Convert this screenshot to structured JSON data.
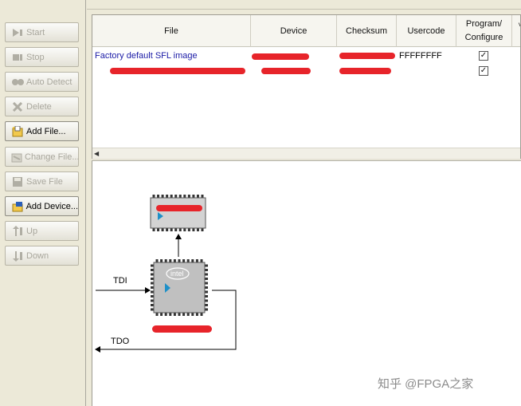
{
  "toolbar": {
    "buttons": [
      {
        "label": "Start",
        "icon": "start-icon",
        "enabled": false
      },
      {
        "label": "Stop",
        "icon": "stop-icon",
        "enabled": false
      },
      {
        "label": "Auto Detect",
        "icon": "auto-detect-icon",
        "enabled": false
      },
      {
        "label": "Delete",
        "icon": "delete-icon",
        "enabled": false
      },
      {
        "label": "Add File...",
        "icon": "add-file-icon",
        "enabled": true
      },
      {
        "label": "Change File...",
        "icon": "change-file-icon",
        "enabled": false
      },
      {
        "label": "Save File",
        "icon": "save-file-icon",
        "enabled": false
      },
      {
        "label": "Add Device...",
        "icon": "add-device-icon",
        "enabled": true
      },
      {
        "label": "Up",
        "icon": "up-icon",
        "enabled": false
      },
      {
        "label": "Down",
        "icon": "down-icon",
        "enabled": false
      }
    ]
  },
  "table": {
    "headers": {
      "file": "File",
      "device": "Device",
      "checksum": "Checksum",
      "usercode": "Usercode",
      "program_line1": "Program/",
      "program_line2": "Configure"
    },
    "rows": [
      {
        "file": "Factory default SFL image",
        "usercode": "FFFFFFFF",
        "program": "✓"
      },
      {
        "file": "",
        "usercode": "",
        "program": "✓"
      }
    ]
  },
  "diagram": {
    "tdi_label": "TDI",
    "tdo_label": "TDO",
    "chip_logo": "intel"
  },
  "watermark": "知乎 @FPGA之家",
  "colors": {
    "redaction": "#e7242a",
    "link_blue": "#1a1aa6",
    "chip_gray": "#c0c0c0",
    "arrow_cyan": "#1e90c8"
  }
}
